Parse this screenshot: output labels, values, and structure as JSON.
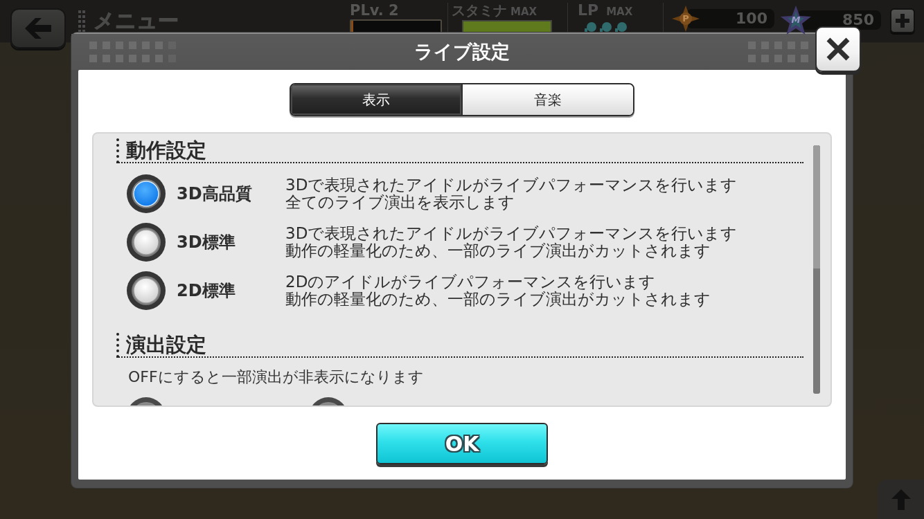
{
  "top_bar": {
    "title": "メニュー",
    "player_level": {
      "label": "PLv. 2",
      "level": 0.02
    },
    "stamina": {
      "label": "スタミナ",
      "badge": "MAX",
      "level": 1
    },
    "lp": {
      "label": "LP",
      "badge": "MAX"
    },
    "currencies": [
      {
        "kind": "diamond",
        "symbol": "P",
        "amount": "100"
      },
      {
        "kind": "star",
        "symbol": "M",
        "amount": "850"
      }
    ]
  },
  "dialog": {
    "title": "ライブ設定",
    "tabs": [
      {
        "label": "表示",
        "selected": true
      },
      {
        "label": "音楽",
        "selected": false
      }
    ],
    "sections": [
      {
        "kind": "list",
        "title": "動作設定",
        "options": [
          {
            "kind": "radio",
            "label": "3D高品質",
            "description": [
              "3Dで表現されたアイドルがライブパフォーマンスを行います",
              "全てのライブ演出を表示します"
            ],
            "selected": true
          },
          {
            "kind": "radio",
            "label": "3D標準",
            "description": [
              "3Dで表現されたアイドルがライブパフォーマンスを行います",
              "動作の軽量化のため、一部のライブ演出がカットされます"
            ],
            "selected": false
          },
          {
            "kind": "radio",
            "label": "2D標準",
            "description": [
              "2Dのアイドルがライブパフォーマンスを行います",
              "動作の軽量化のため、一部のライブ演出がカットされます"
            ],
            "selected": false
          }
        ]
      },
      {
        "kind": "row",
        "title": "演出設定",
        "note": "OFFにすると一部演出が非表示になります",
        "options": [
          {
            "kind": "radio"
          },
          {
            "kind": "radio"
          }
        ]
      }
    ],
    "ok_button": "OK"
  }
}
